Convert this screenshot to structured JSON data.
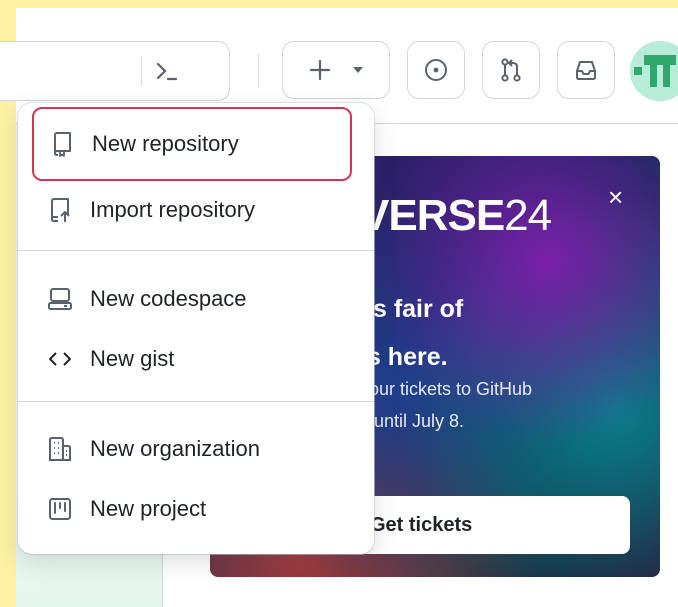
{
  "banner": {
    "logo_bold": "VERSE",
    "logo_thin": "24",
    "close_symbol": "×",
    "headline_line1": "l’s fair of",
    "headline_line2": "is here.",
    "text_line1": "your tickets to GitHub",
    "text_line2": "y until July 8.",
    "button_label": "Get tickets"
  },
  "create_menu": {
    "items": [
      {
        "label": "New repository",
        "icon": "repo-icon"
      },
      {
        "label": "Import repository",
        "icon": "repo-push-icon"
      },
      {
        "label": "New codespace",
        "icon": "codespaces-icon"
      },
      {
        "label": "New gist",
        "icon": "code-icon"
      },
      {
        "label": "New organization",
        "icon": "organization-icon"
      },
      {
        "label": "New project",
        "icon": "project-icon"
      }
    ]
  },
  "toolbar": {
    "command_palette_icon": "terminal-icon",
    "create_icon": "plus-icon",
    "issues_icon": "issue-opened-icon",
    "pull_requests_icon": "git-pull-request-icon",
    "inbox_icon": "inbox-icon"
  },
  "colors": {
    "highlight_border": "#d33552",
    "background": "#fdf2a3",
    "avatar_bg": "#b8ecd8",
    "avatar_fg": "#2ea86b"
  }
}
